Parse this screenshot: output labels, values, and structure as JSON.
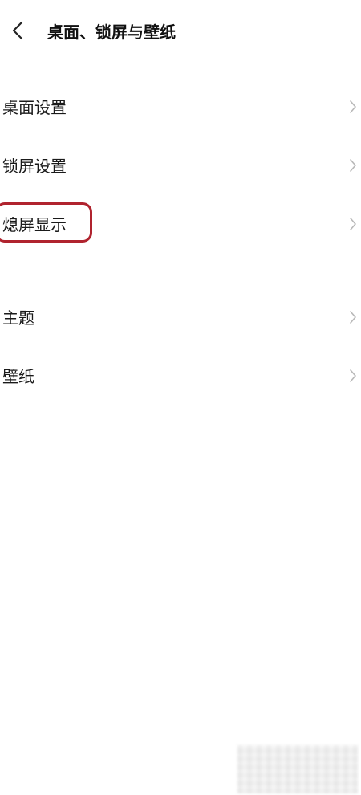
{
  "header": {
    "back_icon": "chevron-left-icon",
    "title": "桌面、锁屏与壁纸"
  },
  "group1": {
    "items": [
      {
        "label": "桌面设置",
        "icon": "chevron-right-icon"
      },
      {
        "label": "锁屏设置",
        "icon": "chevron-right-icon"
      },
      {
        "label": "熄屏显示",
        "icon": "chevron-right-icon"
      }
    ]
  },
  "group2": {
    "items": [
      {
        "label": "主题",
        "icon": "chevron-right-icon"
      },
      {
        "label": "壁纸",
        "icon": "chevron-right-icon"
      }
    ]
  },
  "colors": {
    "highlight_border": "#b0232e",
    "chevron": "#b8b8b8",
    "text": "#1a1a1a"
  }
}
